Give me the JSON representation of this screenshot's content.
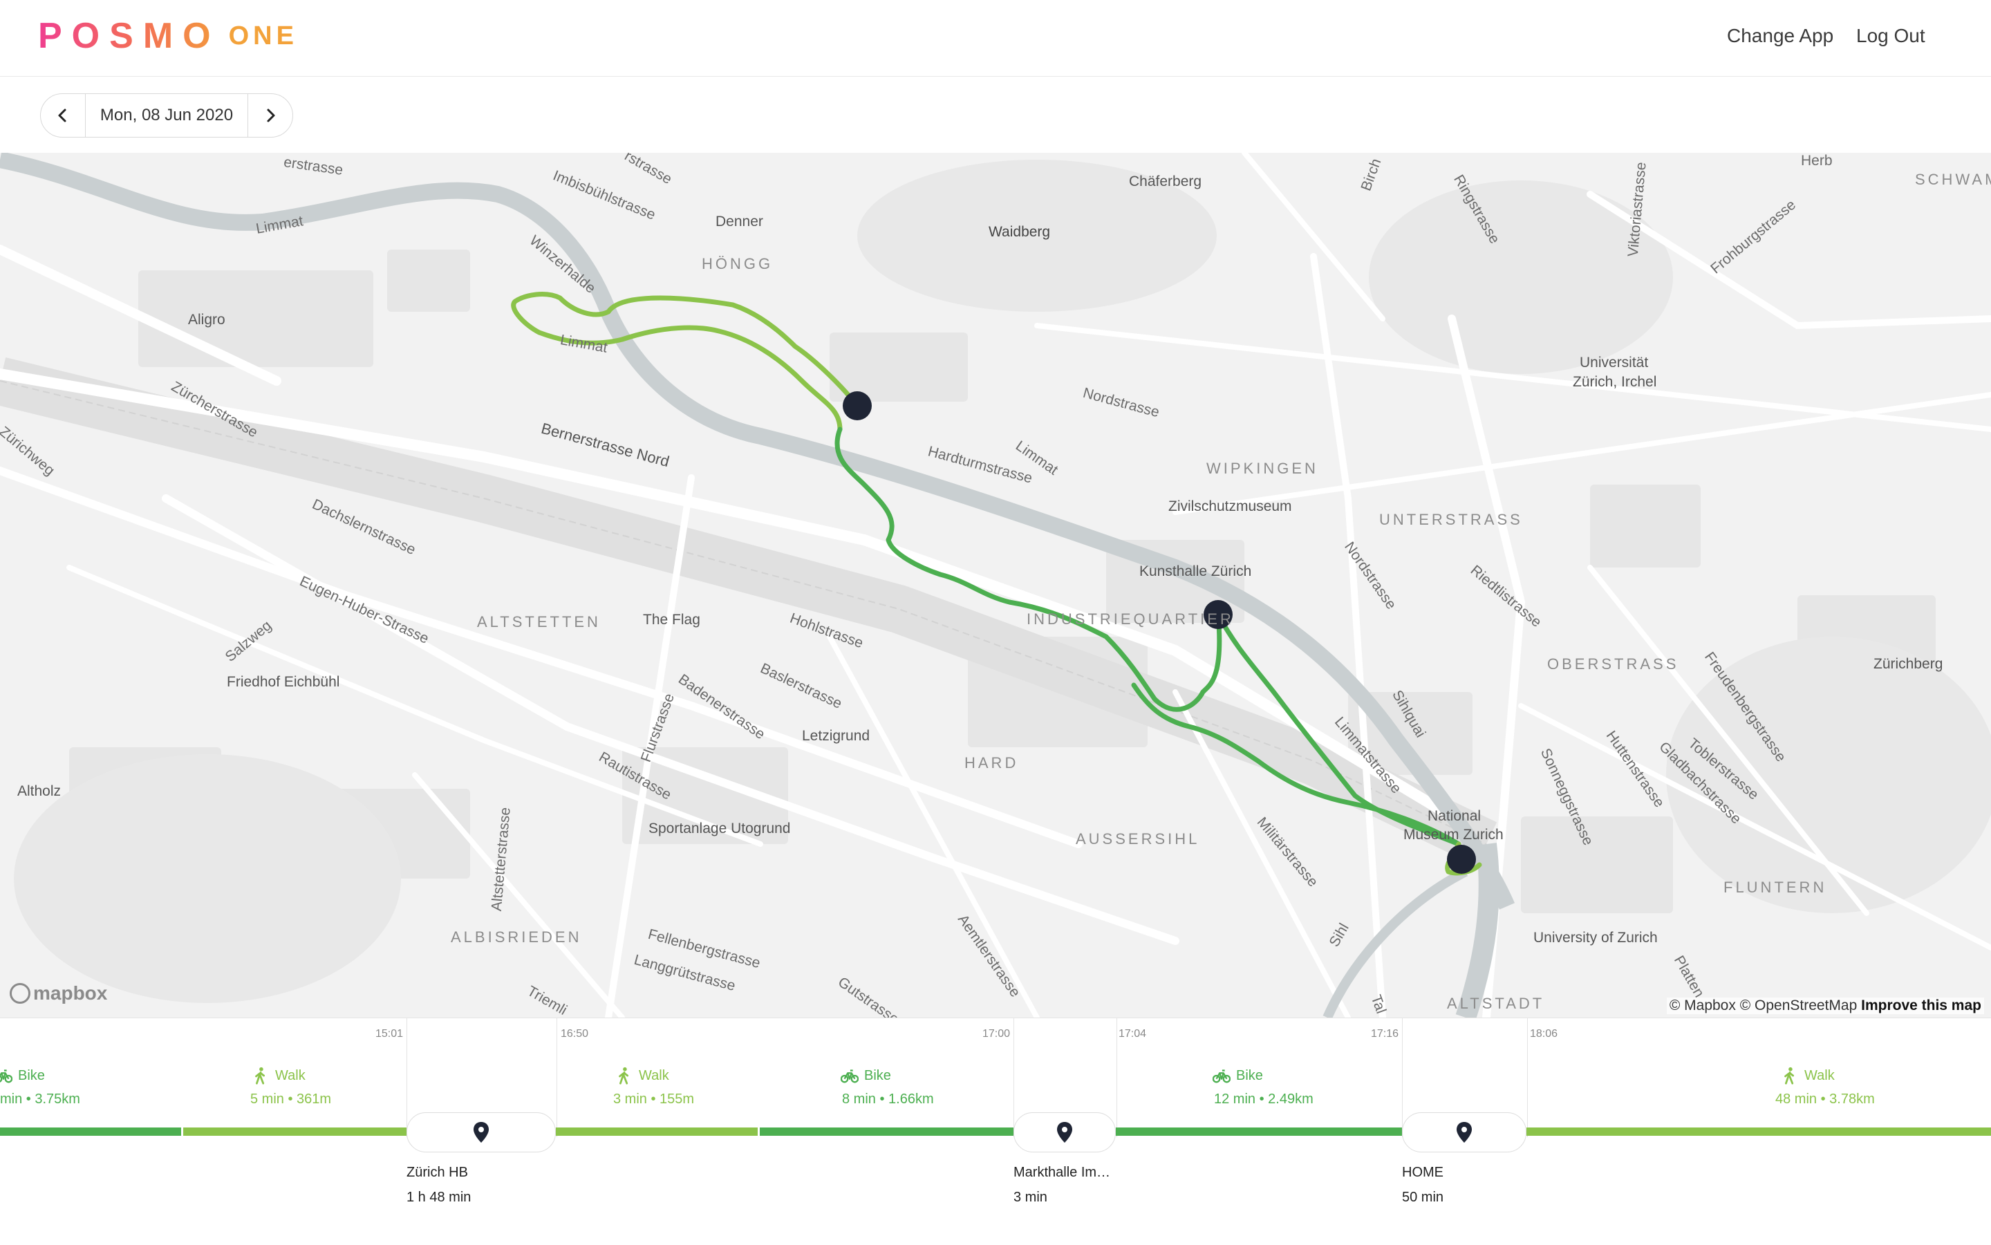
{
  "header": {
    "logo_main": "POSMO",
    "logo_sub": "ONE",
    "change_app": "Change App",
    "log_out": "Log Out"
  },
  "datebar": {
    "date": "Mon, 08 Jun 2020",
    "prev_icon": "chevron-left-icon",
    "next_icon": "chevron-right-icon"
  },
  "map": {
    "labels": {
      "erstrasse": "erstrasse",
      "limmat1": "Limmat",
      "imbisbuehl": "Imbisbühlstrasse",
      "rstrasse": "rstrasse",
      "denner": "Denner",
      "hoengg": "HÖNGG",
      "chaeferberg": "Chäferberg",
      "waidberg": "Waidberg",
      "birch": "Birch",
      "ringstrasse": "Ringstrasse",
      "viktoriastrasse": "Viktoriastrasse",
      "herb": "Herb",
      "schwam": "SCHWAM",
      "frohburg": "Frohburgstrasse",
      "winzerhalde": "Winzerhalde",
      "aligro": "Aligro",
      "limmat2": "Limmat",
      "universitaet": "Universität",
      "zuerich_irchel": "Zürich, Irchel",
      "zuercherstrasse": "Zürcherstrasse",
      "nordstrasse": "Nordstrasse",
      "zuerichweg": "Zürichweg",
      "bernerstrasse": "Bernerstrasse Nord",
      "hardturmstrasse": "Hardturmstrasse",
      "limmat3": "Limmat",
      "wipkingen": "WIPKINGEN",
      "zivilschutzmuseum": "Zivilschutzmuseum",
      "unterstrass": "UNTERSTRASS",
      "dachslern": "Dachslernstrasse",
      "nordstrasse2": "Nordstrasse",
      "riedtli": "Riedtlistrasse",
      "kunsthalle": "Kunsthalle Zürich",
      "eugenhuber": "Eugen-Huber-Strasse",
      "altstetten": "ALTSTETTEN",
      "theflag": "The Flag",
      "hohlstrasse": "Hohlstrasse",
      "industriequartier": "INDUSTRIEQUARTIER",
      "oberstrass": "OBERSTRASS",
      "zuerichberg": "Zürichberg",
      "salzweg": "Salzweg",
      "friedhof": "Friedhof Eichbühl",
      "baslerstrasse": "Baslerstrasse",
      "badenerstrasse": "Badenerstrasse",
      "sihlquai": "Sihlquai",
      "freudenberg": "Freudenbergstrasse",
      "letzigrund": "Letzigrund",
      "flurstrasse": "Flurstrasse",
      "limmatstrasse": "Limmatstrasse",
      "altholz": "Altholz",
      "rautistrasse": "Rautistrasse",
      "hard": "HARD",
      "sonnegg": "Sonneggstrasse",
      "hutten": "Huttenstrasse",
      "gladbach": "Gladbachstrasse",
      "tobler": "Toblerstrasse",
      "national": "National",
      "museum_zurich": "Museum Zurich",
      "sportanlage": "Sportanlage Utogrund",
      "aussersihl": "AUSSERSIHL",
      "militaer": "Militärstrasse",
      "altstetterstrasse": "Altstetterstrasse",
      "fluntern": "FLUNTERN",
      "albisrieden": "ALBISRIEDEN",
      "fellenberg": "Fellenbergstrasse",
      "sihl": "Sihl",
      "university": "University of Zurich",
      "langgruet": "Langgrütstrasse",
      "aemtler": "Aemtlerstrasse",
      "triemli": "Triemli",
      "gutstrasse": "Gutstrasse",
      "platten": "Platten",
      "altstadt": "ALTSTADT",
      "tal": "Tal"
    },
    "mapbox_logo": "mapbox",
    "attribution": "© Mapbox © OpenStreetMap",
    "improve": "Improve this map",
    "colors": {
      "bike_route": "#4caf50",
      "walk_route": "#8bc34a",
      "stop_marker": "#1f2535",
      "river": "#c9cfd1"
    }
  },
  "timeline": {
    "ticks": [
      "15:01",
      "16:50",
      "17:00",
      "17:04",
      "17:16",
      "18:06"
    ],
    "segments": [
      {
        "mode": "Bike",
        "icon": "bike-icon",
        "detail": "min • 3.75km"
      },
      {
        "mode": "Walk",
        "icon": "walk-icon",
        "detail": "5 min • 361m"
      },
      {
        "mode": "Walk",
        "icon": "walk-icon",
        "detail": "3 min • 155m"
      },
      {
        "mode": "Bike",
        "icon": "bike-icon",
        "detail": "8 min • 1.66km"
      },
      {
        "mode": "Bike",
        "icon": "bike-icon",
        "detail": "12 min • 2.49km"
      },
      {
        "mode": "Walk",
        "icon": "walk-icon",
        "detail": "48 min • 3.78km"
      }
    ],
    "stops": [
      {
        "name": "Zürich HB",
        "duration": "1 h 48 min",
        "icon": "map-pin-icon"
      },
      {
        "name": "Markthalle Im…",
        "duration": "3 min",
        "icon": "map-pin-icon"
      },
      {
        "name": "HOME",
        "duration": "50 min",
        "icon": "map-pin-icon"
      }
    ]
  }
}
